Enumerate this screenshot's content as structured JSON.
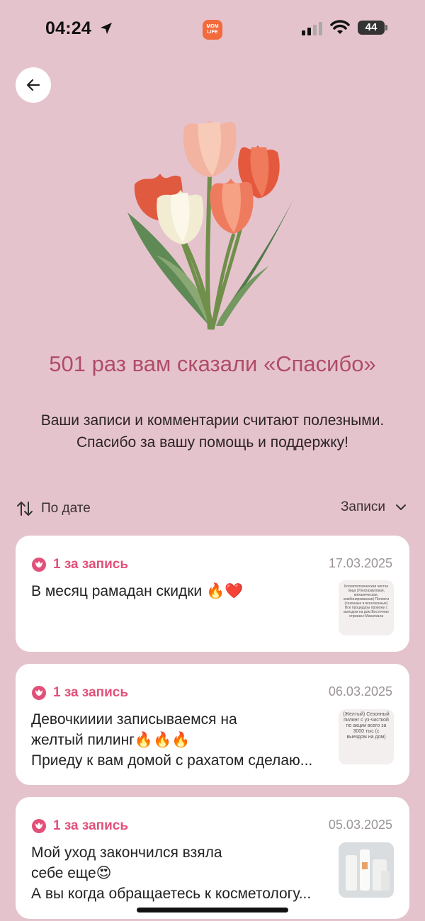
{
  "status_bar": {
    "time": "04:24",
    "app_badge_line1": "MOM",
    "app_badge_line2": "LIFE",
    "battery": "44"
  },
  "hero": {
    "title": "501 раз вам сказали «Спасибо»",
    "subtitle_line1": "Ваши записи и комментарии считают полезными.",
    "subtitle_line2": "Спасибо за вашу помощь и поддержку!"
  },
  "sort": {
    "label": "По дате",
    "filter_label": "Записи"
  },
  "cards": [
    {
      "badge": "1 за запись",
      "date": "17.03.2025",
      "lines": [
        "В месяц рамадан скидки 🔥❤️"
      ],
      "thumb_text": "Косметологическая чистка лица (Ультразвуковая, механическая, комбинированная) Пилинги (сезонные и всесезонные) Все процедуры провожу с выездом на дом Восточная стрижка г.Махачкала"
    },
    {
      "badge": "1 за запись",
      "date": "06.03.2025",
      "lines": [
        "Девочкииии записываемся на",
        "желтый пилинг🔥🔥🔥",
        "Приеду к вам домой с рахатом сделаю..."
      ],
      "thumb_text": "(Желтый) Сезонный пилинг с уз-чисткой по акции всего за 3000 тыс (с выездом на дом)"
    },
    {
      "badge": "1 за запись",
      "date": "05.03.2025",
      "lines": [
        "Мой уход закончился взяла",
        "себе еще😍",
        "А вы когда обращаетесь к косметологу..."
      ],
      "thumb_text": ""
    }
  ],
  "colors": {
    "background": "#e5c3cd",
    "accent_title": "#b04c6a",
    "badge": "#e2507a"
  },
  "icons": [
    "location-arrow-icon",
    "signal-icon",
    "wifi-icon",
    "back-arrow-icon",
    "sort-arrows-icon",
    "chevron-down-icon",
    "tulip-icon"
  ]
}
